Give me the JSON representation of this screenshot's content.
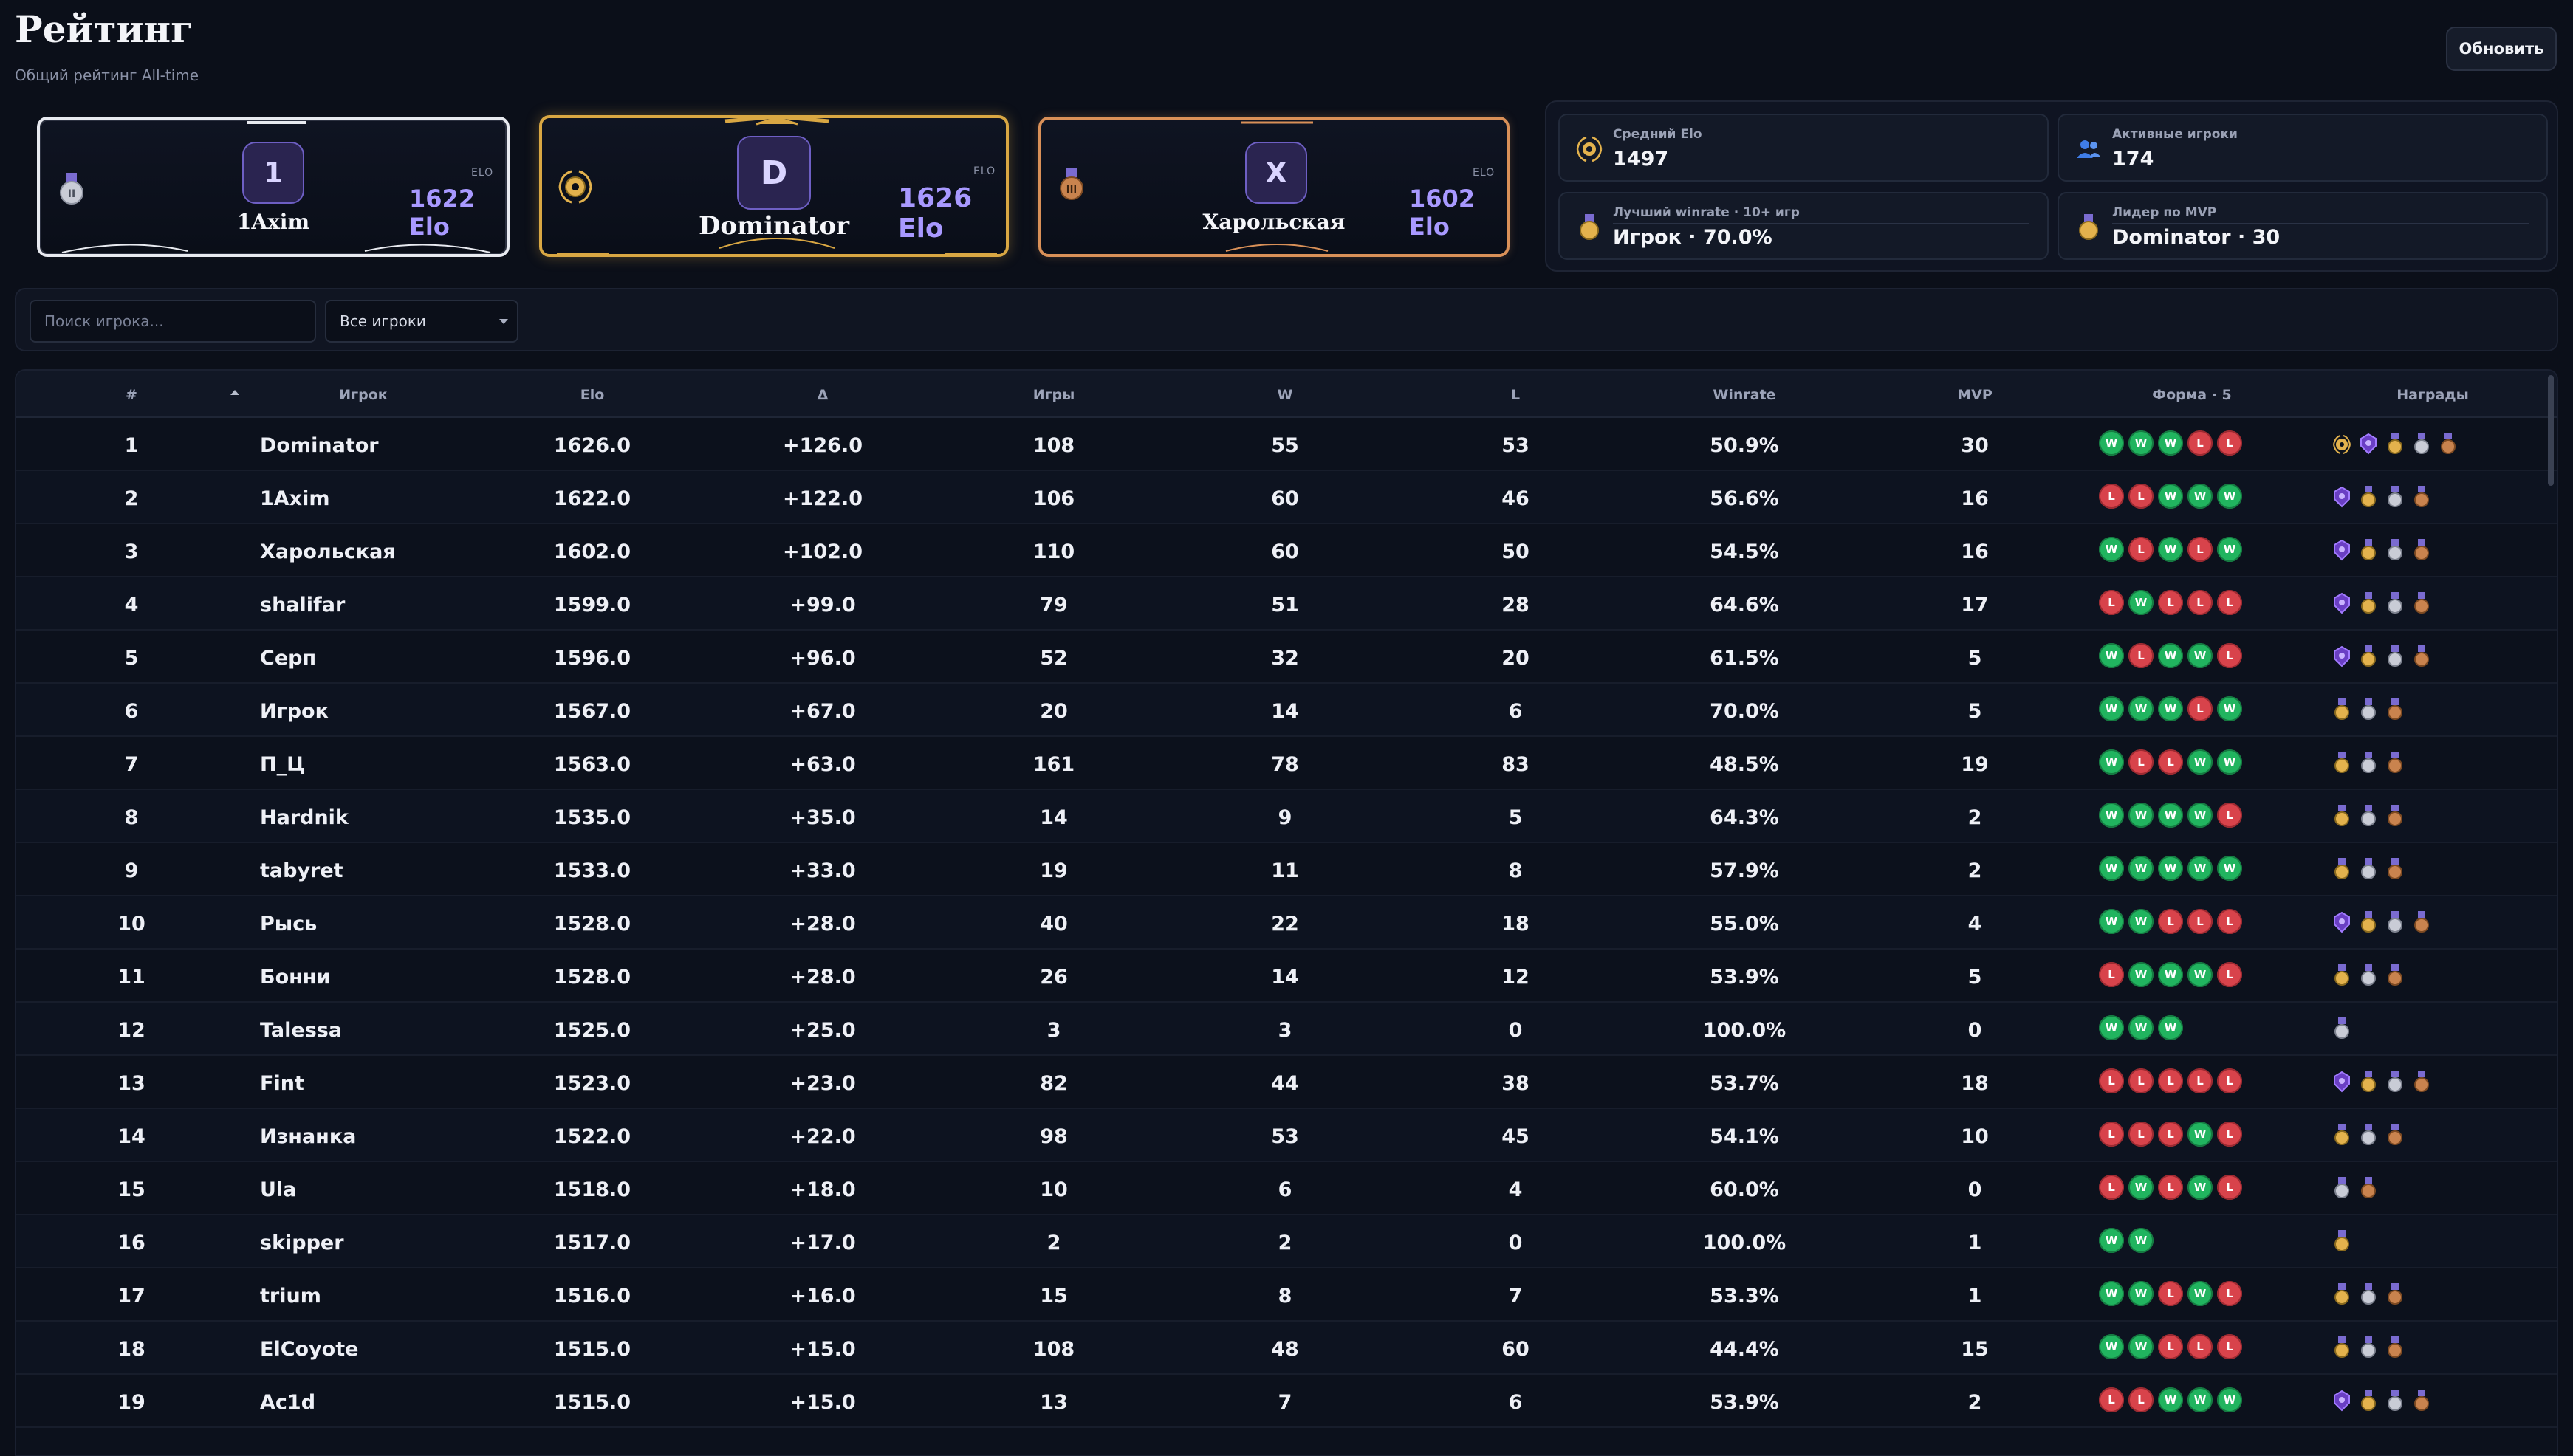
{
  "header": {
    "title": "Рейтинг",
    "subtitle": "Общий рейтинг All-time",
    "refresh_label": "Обновить"
  },
  "podium": [
    {
      "place": 2,
      "initial": "1",
      "name": "1Axim",
      "elo_tag": "ELO",
      "elo": "1622 Elo",
      "medal": "silver-medal-icon"
    },
    {
      "place": 1,
      "initial": "D",
      "name": "Dominator",
      "elo_tag": "ELO",
      "elo": "1626 Elo",
      "medal": "gold-laurel-icon"
    },
    {
      "place": 3,
      "initial": "X",
      "name": "Харольская",
      "elo_tag": "ELO",
      "elo": "1602 Elo",
      "medal": "bronze-medal-icon"
    }
  ],
  "stats": {
    "avg_elo": {
      "label": "Средний Elo",
      "value": "1497"
    },
    "active": {
      "label": "Активные игроки",
      "value": "174"
    },
    "best_winrate": {
      "label": "Лучший winrate · 10+ игр",
      "value": "Игрок · 70.0%"
    },
    "mvp_leader": {
      "label": "Лидер по MVP",
      "value": "Dominator · 30"
    }
  },
  "filters": {
    "search_placeholder": "Поиск игрока...",
    "select_value": "Все игроки"
  },
  "colors": {
    "win": "#21b45f",
    "loss": "#d8434b",
    "gold": "#d9a743",
    "silver": "#e8eaf0",
    "bronze": "#d99058",
    "accent": "#a899ff"
  },
  "table": {
    "columns": [
      "#",
      "Игрок",
      "Elo",
      "Δ",
      "Игры",
      "W",
      "L",
      "Winrate",
      "MVP",
      "Форма · 5",
      "Награды"
    ],
    "rows": [
      {
        "rank": "1",
        "name": "Dominator",
        "elo": "1626.0",
        "delta": "+126.0",
        "games": "108",
        "w": "55",
        "l": "53",
        "winrate": "50.9%",
        "mvp": "30",
        "form": [
          "W",
          "W",
          "W",
          "L",
          "L"
        ],
        "awards": [
          "laurel",
          "purple",
          "gold",
          "silver",
          "bronze"
        ]
      },
      {
        "rank": "2",
        "name": "1Axim",
        "elo": "1622.0",
        "delta": "+122.0",
        "games": "106",
        "w": "60",
        "l": "46",
        "winrate": "56.6%",
        "mvp": "16",
        "form": [
          "L",
          "L",
          "W",
          "W",
          "W"
        ],
        "awards": [
          "purple",
          "gold",
          "silver",
          "bronze"
        ]
      },
      {
        "rank": "3",
        "name": "Харольская",
        "elo": "1602.0",
        "delta": "+102.0",
        "games": "110",
        "w": "60",
        "l": "50",
        "winrate": "54.5%",
        "mvp": "16",
        "form": [
          "W",
          "L",
          "W",
          "L",
          "W"
        ],
        "awards": [
          "purple",
          "gold",
          "silver",
          "bronze"
        ]
      },
      {
        "rank": "4",
        "name": "shalifar",
        "elo": "1599.0",
        "delta": "+99.0",
        "games": "79",
        "w": "51",
        "l": "28",
        "winrate": "64.6%",
        "mvp": "17",
        "form": [
          "L",
          "W",
          "L",
          "L",
          "L"
        ],
        "awards": [
          "purple",
          "gold",
          "silver",
          "bronze"
        ]
      },
      {
        "rank": "5",
        "name": "Серп",
        "elo": "1596.0",
        "delta": "+96.0",
        "games": "52",
        "w": "32",
        "l": "20",
        "winrate": "61.5%",
        "mvp": "5",
        "form": [
          "W",
          "L",
          "W",
          "W",
          "L"
        ],
        "awards": [
          "purple",
          "gold",
          "silver",
          "bronze"
        ]
      },
      {
        "rank": "6",
        "name": "Игрок",
        "elo": "1567.0",
        "delta": "+67.0",
        "games": "20",
        "w": "14",
        "l": "6",
        "winrate": "70.0%",
        "mvp": "5",
        "form": [
          "W",
          "W",
          "W",
          "L",
          "W"
        ],
        "awards": [
          "gold",
          "silver",
          "bronze"
        ]
      },
      {
        "rank": "7",
        "name": "П_Ц",
        "elo": "1563.0",
        "delta": "+63.0",
        "games": "161",
        "w": "78",
        "l": "83",
        "winrate": "48.5%",
        "mvp": "19",
        "form": [
          "W",
          "L",
          "L",
          "W",
          "W"
        ],
        "awards": [
          "gold",
          "silver",
          "bronze"
        ]
      },
      {
        "rank": "8",
        "name": "Hardnik",
        "elo": "1535.0",
        "delta": "+35.0",
        "games": "14",
        "w": "9",
        "l": "5",
        "winrate": "64.3%",
        "mvp": "2",
        "form": [
          "W",
          "W",
          "W",
          "W",
          "L"
        ],
        "awards": [
          "gold",
          "silver",
          "bronze"
        ]
      },
      {
        "rank": "9",
        "name": "tabyret",
        "elo": "1533.0",
        "delta": "+33.0",
        "games": "19",
        "w": "11",
        "l": "8",
        "winrate": "57.9%",
        "mvp": "2",
        "form": [
          "W",
          "W",
          "W",
          "W",
          "W"
        ],
        "awards": [
          "gold",
          "silver",
          "bronze"
        ]
      },
      {
        "rank": "10",
        "name": "Рысь",
        "elo": "1528.0",
        "delta": "+28.0",
        "games": "40",
        "w": "22",
        "l": "18",
        "winrate": "55.0%",
        "mvp": "4",
        "form": [
          "W",
          "W",
          "L",
          "L",
          "L"
        ],
        "awards": [
          "purple",
          "gold",
          "silver",
          "bronze"
        ]
      },
      {
        "rank": "11",
        "name": "Бонни",
        "elo": "1528.0",
        "delta": "+28.0",
        "games": "26",
        "w": "14",
        "l": "12",
        "winrate": "53.9%",
        "mvp": "5",
        "form": [
          "L",
          "W",
          "W",
          "W",
          "L"
        ],
        "awards": [
          "gold",
          "silver",
          "bronze"
        ]
      },
      {
        "rank": "12",
        "name": "Talessa",
        "elo": "1525.0",
        "delta": "+25.0",
        "games": "3",
        "w": "3",
        "l": "0",
        "winrate": "100.0%",
        "mvp": "0",
        "form": [
          "W",
          "W",
          "W"
        ],
        "awards": [
          "silver"
        ]
      },
      {
        "rank": "13",
        "name": "Fint",
        "elo": "1523.0",
        "delta": "+23.0",
        "games": "82",
        "w": "44",
        "l": "38",
        "winrate": "53.7%",
        "mvp": "18",
        "form": [
          "L",
          "L",
          "L",
          "L",
          "L"
        ],
        "awards": [
          "purple",
          "gold",
          "silver",
          "bronze"
        ]
      },
      {
        "rank": "14",
        "name": "Изнанка",
        "elo": "1522.0",
        "delta": "+22.0",
        "games": "98",
        "w": "53",
        "l": "45",
        "winrate": "54.1%",
        "mvp": "10",
        "form": [
          "L",
          "L",
          "L",
          "W",
          "L"
        ],
        "awards": [
          "gold",
          "silver",
          "bronze"
        ]
      },
      {
        "rank": "15",
        "name": "Ula",
        "elo": "1518.0",
        "delta": "+18.0",
        "games": "10",
        "w": "6",
        "l": "4",
        "winrate": "60.0%",
        "mvp": "0",
        "form": [
          "L",
          "W",
          "L",
          "W",
          "L"
        ],
        "awards": [
          "silver",
          "bronze"
        ]
      },
      {
        "rank": "16",
        "name": "skipper",
        "elo": "1517.0",
        "delta": "+17.0",
        "games": "2",
        "w": "2",
        "l": "0",
        "winrate": "100.0%",
        "mvp": "1",
        "form": [
          "W",
          "W"
        ],
        "awards": [
          "gold"
        ]
      },
      {
        "rank": "17",
        "name": "trium",
        "elo": "1516.0",
        "delta": "+16.0",
        "games": "15",
        "w": "8",
        "l": "7",
        "winrate": "53.3%",
        "mvp": "1",
        "form": [
          "W",
          "W",
          "L",
          "W",
          "L"
        ],
        "awards": [
          "gold",
          "silver",
          "bronze"
        ]
      },
      {
        "rank": "18",
        "name": "ElCoyote",
        "elo": "1515.0",
        "delta": "+15.0",
        "games": "108",
        "w": "48",
        "l": "60",
        "winrate": "44.4%",
        "mvp": "15",
        "form": [
          "W",
          "W",
          "L",
          "L",
          "L"
        ],
        "awards": [
          "gold",
          "silver",
          "bronze"
        ]
      },
      {
        "rank": "19",
        "name": "Ac1d",
        "elo": "1515.0",
        "delta": "+15.0",
        "games": "13",
        "w": "7",
        "l": "6",
        "winrate": "53.9%",
        "mvp": "2",
        "form": [
          "L",
          "L",
          "W",
          "W",
          "W"
        ],
        "awards": [
          "purple",
          "gold",
          "silver",
          "bronze"
        ]
      }
    ]
  }
}
